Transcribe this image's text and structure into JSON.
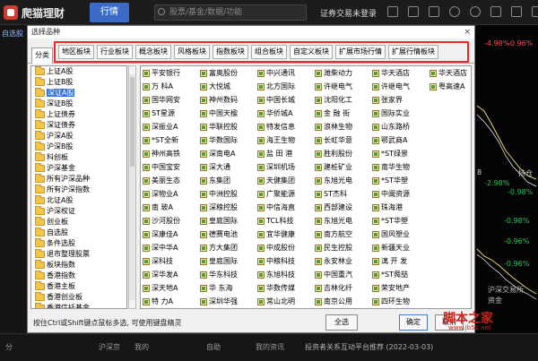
{
  "app": {
    "name": "爬猫理财",
    "tab_quotes": "行情",
    "search_placeholder": "股票/基金/数据/功能",
    "trade_login": "证券交易未登录"
  },
  "left_strip": {
    "label": "自选股"
  },
  "dialog": {
    "title": "选择品种",
    "close": "×",
    "side_tab": "分类",
    "categories": [
      "地区板块",
      "行业板块",
      "概念板块",
      "风格板块",
      "指数板块",
      "组合板块",
      "自定义板块",
      "扩展市场行情",
      "扩展行情板块"
    ],
    "tree_items": [
      "上证A股",
      "上证B股",
      "深证A股",
      "深证B股",
      "上证债券",
      "深证债券",
      "沪深A股",
      "沪深B股",
      "科创板",
      "沪深基金",
      "所有沪深品种",
      "所有沪深指数",
      "北证A股",
      "沪深权证",
      "创业板",
      "自选股",
      "条件选股",
      "退市整理股票",
      "板块指数",
      "香港指数",
      "香港主板",
      "香港创业板",
      "香港信托基金",
      "港股通"
    ],
    "tree_selected": 2,
    "stock_columns": [
      [
        "平安银行",
        "万 科A",
        "国华网安",
        "ST星源",
        "深振业A",
        "*ST全新",
        "神州高铁",
        "中国宝安",
        "美丽生态",
        "深物业A",
        "南 玻A",
        "沙河股份",
        "深康佳A",
        "深中华A",
        "深科技",
        "深华发A",
        "深天地A",
        "特 力A",
        "飞亚达",
        "深圳能源",
        "国药一致",
        "深深房A"
      ],
      [
        "富奥股份",
        "大悦城",
        "神州数码",
        "中国天楹",
        "华联控股",
        "华数国际",
        "深南电A",
        "深大通",
        "东集团",
        "中洲控股",
        "深粮控股",
        "皇庭国际",
        "德赛电池",
        "方大集团",
        "皇庭国际",
        "华东科技",
        "华 东海",
        "深圳华强",
        "中金岭南",
        "农 产 品",
        "深圳华侨",
        "中国宝安"
      ],
      [
        "中兴通讯",
        "北方国际",
        "中国长城",
        "华侨城A",
        "特发信息",
        "海王生物",
        "盐 田 港",
        "深圳机场",
        "天健集团",
        "广聚能源",
        "中信海直",
        "TCL科技",
        "宜华健康",
        "中成股份",
        "中粮科技",
        "东旭科技",
        "华数传媒",
        "常山北明",
        "中粮糖业",
        "国际实业",
        "申万宏源",
        "粤宏远A"
      ],
      [
        "潍柴动力",
        "许继电气",
        "沈阳化工",
        "金 融 街",
        "浪林生物",
        "长虹华意",
        "胜利股份",
        "建桩矿业",
        "东旭光电",
        "ST杰科",
        "西部建设",
        "东旭光电",
        "南方航空",
        "民生控股",
        "永安林业",
        "中国重汽",
        "吉林化纤",
        "南京公用",
        "湖北宜化",
        "东阿阿胶",
        "徐工机械",
        "兴业矿业"
      ],
      [
        "华天酒店",
        "许继电气",
        "张家界",
        "国际实业",
        "山东路桥",
        "鄂武商A",
        "*ST绿景",
        "南华生物",
        "*ST华塑",
        "中闽资源",
        "珠海港",
        "*ST华塑",
        "国风塑业",
        "新疆天业",
        "漓 开 发",
        "*ST舜喆",
        "荣安地产",
        "四环生物",
        "中兵红箭",
        "长航凤凰",
        "长航美盛",
        "ST湿高"
      ],
      [
        "华天酒店",
        "粤高速A"
      ]
    ],
    "footer_hint": "按住Ctrl或Shift键点鼠标多选, 可使用键盘精灵",
    "select_all": "全选",
    "ok": "确定",
    "cancel": "取消"
  },
  "chart": {
    "pct_values": [
      "-4.98%",
      "-0.96%",
      "-2.98%",
      "-0.98%",
      "-0.98%",
      "-0.96%",
      "-0.96%"
    ],
    "labels": [
      "8",
      "持仓"
    ],
    "side_text": [
      "沪深交易所",
      "资金"
    ]
  },
  "bottom_bar": {
    "items": [
      "分",
      "沪深京",
      "我的",
      "自助",
      "我的资讯"
    ],
    "ticker": "投资者关系互动平台推荐 (2022-03-03)"
  },
  "watermark": {
    "text": "脚本之家",
    "url": "www.jb51.net"
  }
}
